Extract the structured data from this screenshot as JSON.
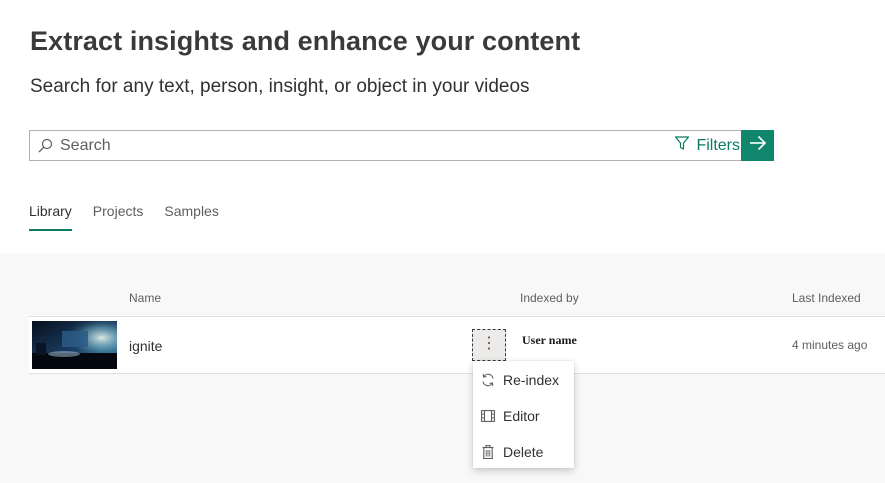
{
  "header": {
    "title": "Extract insights and enhance your content",
    "subtitle": "Search for any text, person, insight, or object in your videos"
  },
  "search": {
    "placeholder": "Search",
    "value": "",
    "filters_label": "Filters",
    "icons": {
      "search": "search-icon",
      "filter": "filter-icon",
      "go": "arrow-right-icon"
    },
    "accent_color": "#10866c"
  },
  "tabs": [
    {
      "label": "Library",
      "active": true
    },
    {
      "label": "Projects",
      "active": false
    },
    {
      "label": "Samples",
      "active": false
    }
  ],
  "table": {
    "columns": {
      "name": "Name",
      "indexed_by": "Indexed by",
      "last_indexed": "Last Indexed"
    },
    "rows": [
      {
        "name": "ignite",
        "indexed_by": "User name",
        "last_indexed": "4 minutes ago"
      }
    ]
  },
  "context_menu": {
    "items": [
      {
        "label": "Re-index",
        "icon": "refresh-icon"
      },
      {
        "label": "Editor",
        "icon": "film-icon"
      },
      {
        "label": "Delete",
        "icon": "trash-icon"
      }
    ]
  }
}
